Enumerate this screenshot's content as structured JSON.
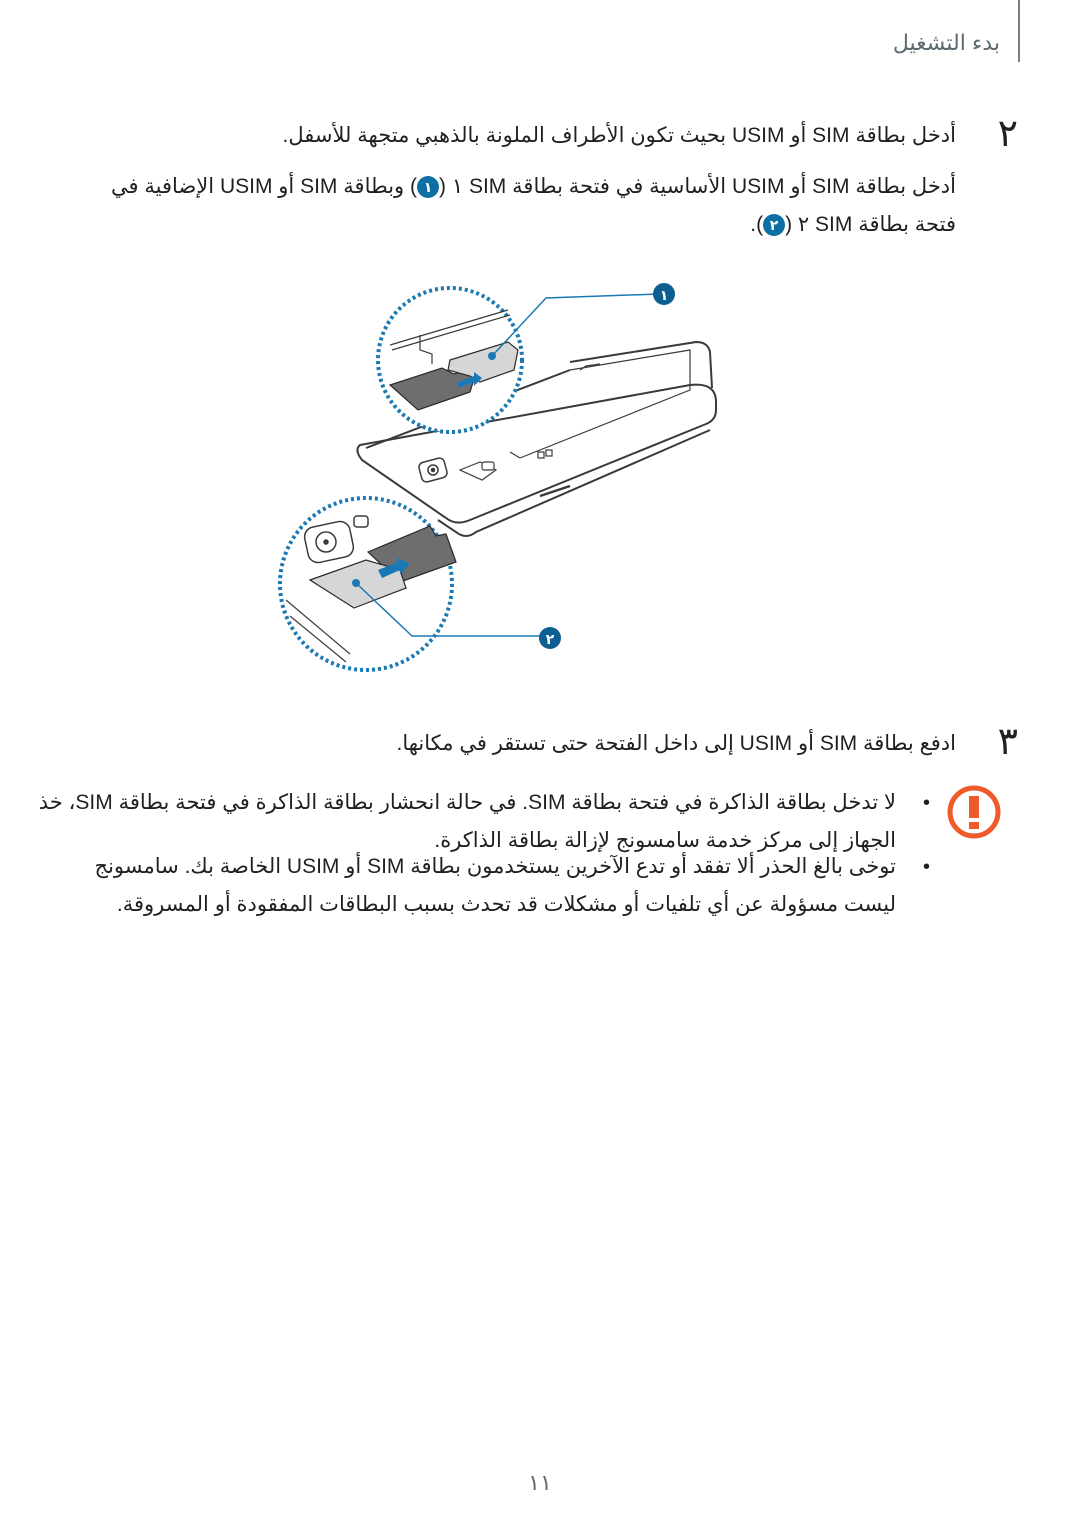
{
  "header": {
    "section_title": "بدء التشغيل"
  },
  "steps": [
    {
      "number": "٢",
      "text": "أدخل بطاقة SIM أو USIM بحيث تكون الأطراف الملونة بالذهبي متجهة للأسفل.",
      "detail_line1_part1": "أدخل بطاقة SIM أو USIM الأساسية في فتحة بطاقة SIM ١ (",
      "detail_badge1": "١",
      "detail_line1_part2": ") وبطاقة SIM أو USIM الإضافية في",
      "detail_line2_part1": "فتحة بطاقة SIM ٢ (",
      "detail_badge2": "٢",
      "detail_line2_part2": ")."
    },
    {
      "number": "٣",
      "text": "ادفع بطاقة SIM أو USIM إلى داخل الفتحة حتى تستقر في مكانها."
    }
  ],
  "illustration": {
    "callouts": [
      "١",
      "٢"
    ],
    "accent_color": "#0d6fa3"
  },
  "caution": {
    "icon": "caution-icon",
    "color": "#f05a28",
    "bullets": [
      {
        "line1": "لا تدخل بطاقة الذاكرة في فتحة بطاقة SIM. في حالة انحشار بطاقة الذاكرة في فتحة بطاقة SIM، خذ",
        "line2": "الجهاز إلى مركز خدمة سامسونج لإزالة بطاقة الذاكرة."
      },
      {
        "line1": "توخى بالغ الحذر ألا تفقد أو تدع الآخرين يستخدمون بطاقة SIM أو USIM الخاصة بك. سامسونج",
        "line2": "ليست مسؤولة عن أي تلفيات أو مشكلات قد تحدث بسبب البطاقات المفقودة أو المسروقة."
      }
    ]
  },
  "footer": {
    "page_number": "١١"
  }
}
